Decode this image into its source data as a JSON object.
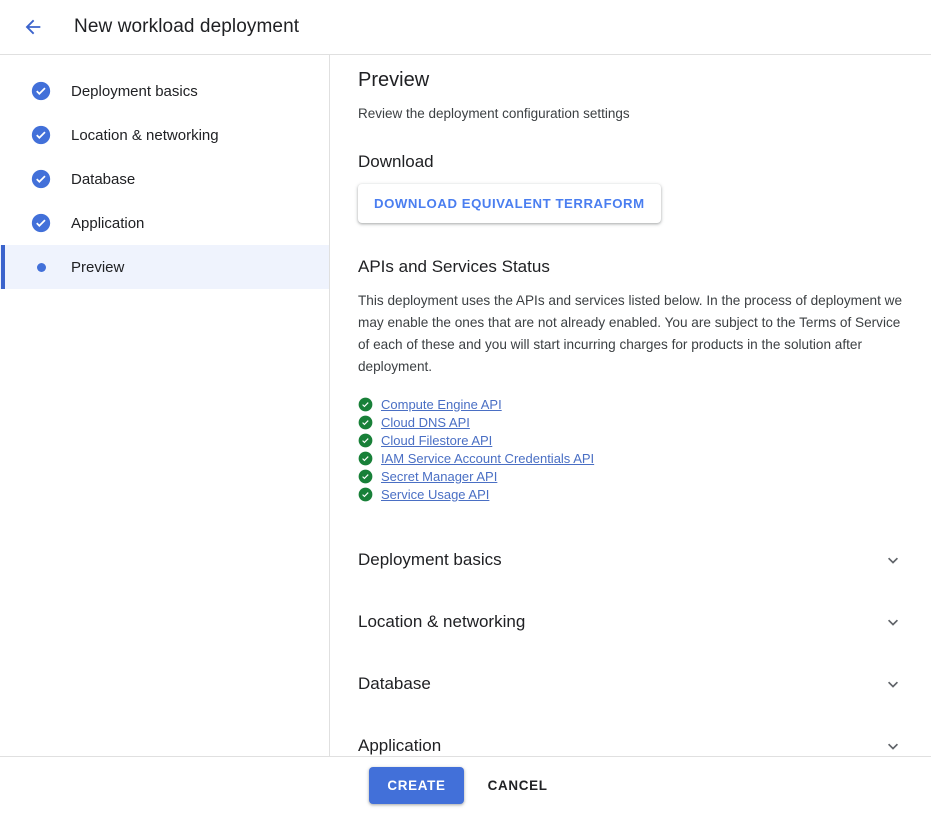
{
  "header": {
    "back_icon": "arrow-left-icon",
    "title": "New workload deployment"
  },
  "sidebar": {
    "steps": [
      {
        "label": "Deployment basics",
        "state": "completed",
        "icon": "check-circle-icon"
      },
      {
        "label": "Location & networking",
        "state": "completed",
        "icon": "check-circle-icon"
      },
      {
        "label": "Database",
        "state": "completed",
        "icon": "check-circle-icon"
      },
      {
        "label": "Application",
        "state": "completed",
        "icon": "check-circle-icon"
      },
      {
        "label": "Preview",
        "state": "active",
        "icon": "dot-icon"
      }
    ]
  },
  "main": {
    "page_title": "Preview",
    "page_subtitle": "Review the deployment configuration settings",
    "download": {
      "heading": "Download",
      "button_label": "DOWNLOAD EQUIVALENT TERRAFORM"
    },
    "apis": {
      "heading": "APIs and Services Status",
      "description": "This deployment uses the APIs and services listed below. In the process of deployment we may enable the ones that are not already enabled. You are subject to the Terms of Service of each of these and you will start incurring charges for products in the solution after deployment.",
      "items": [
        {
          "label": "Compute Engine API",
          "status_icon": "check-circle-green-icon"
        },
        {
          "label": "Cloud DNS API",
          "status_icon": "check-circle-green-icon"
        },
        {
          "label": "Cloud Filestore API",
          "status_icon": "check-circle-green-icon"
        },
        {
          "label": "IAM Service Account Credentials API",
          "status_icon": "check-circle-green-icon"
        },
        {
          "label": "Secret Manager API",
          "status_icon": "check-circle-green-icon"
        },
        {
          "label": "Service Usage API",
          "status_icon": "check-circle-green-icon"
        }
      ]
    },
    "sections": [
      {
        "label": "Deployment basics",
        "expand_icon": "chevron-down-icon"
      },
      {
        "label": "Location & networking",
        "expand_icon": "chevron-down-icon"
      },
      {
        "label": "Database",
        "expand_icon": "chevron-down-icon"
      },
      {
        "label": "Application",
        "expand_icon": "chevron-down-icon"
      }
    ]
  },
  "footer": {
    "create_label": "CREATE",
    "cancel_label": "CANCEL"
  },
  "colors": {
    "accent_blue": "#4270d9",
    "link_blue": "#4a6fc4",
    "active_row_bg": "#eff3fd",
    "success_green": "#188038",
    "divider": "#e0e0e0",
    "text_primary": "#202124"
  }
}
